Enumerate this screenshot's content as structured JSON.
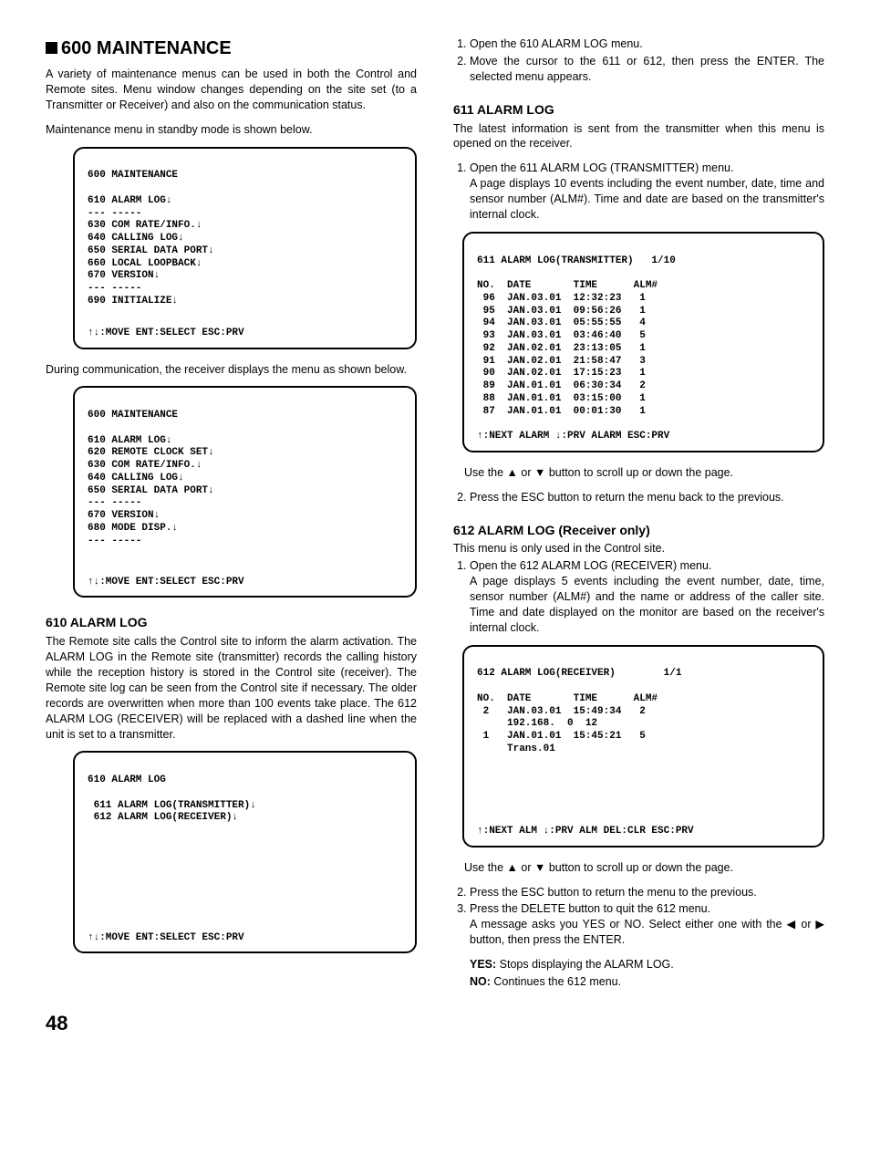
{
  "left": {
    "heading": "600 MAINTENANCE",
    "intro1": "A variety of maintenance menus can be used in both the Control and Remote sites. Menu window changes depending on the site set (to a Transmitter or Receiver) and also on the communication status.",
    "intro2": "Maintenance menu in standby mode is shown below.",
    "term1": "600 MAINTENANCE\n\n610 ALARM LOG↓\n--- -----\n630 COM RATE/INFO.↓\n640 CALLING LOG↓\n650 SERIAL DATA PORT↓\n660 LOCAL LOOPBACK↓\n670 VERSION↓\n--- -----\n690 INITIALIZE↓",
    "term1_footer": "↑↓:MOVE ENT:SELECT ESC:PRV",
    "intro3": "During communication, the receiver displays the menu as shown below.",
    "term2": "600 MAINTENANCE\n\n610 ALARM LOG↓\n620 REMOTE CLOCK SET↓\n630 COM RATE/INFO.↓\n640 CALLING LOG↓\n650 SERIAL DATA PORT↓\n--- -----\n670 VERSION↓\n680 MODE DISP.↓\n--- -----",
    "term2_footer": "↑↓:MOVE ENT:SELECT ESC:PRV",
    "h610": "610 ALARM LOG",
    "p610": "The Remote site calls the Control site to inform the alarm activation. The ALARM LOG in the Remote site (transmitter) records the calling history while the reception history is stored in the Control site (receiver). The Remote site log can be seen from the Control site if necessary. The older records are overwritten when more than 100 events take place. The 612 ALARM LOG (RECEIVER) will be replaced with a dashed line when the unit is set to a transmitter.",
    "term3": "610 ALARM LOG\n\n 611 ALARM LOG(TRANSMITTER)↓\n 612 ALARM LOG(RECEIVER)↓",
    "term3_footer": "↑↓:MOVE ENT:SELECT ESC:PRV"
  },
  "right": {
    "step1": "Open the 610 ALARM LOG menu.",
    "step2": "Move the cursor to the 611 or 612, then press the ENTER. The selected menu appears.",
    "h611": "611 ALARM LOG",
    "p611": "The latest information is sent from the transmitter when this menu is opened on the receiver.",
    "p611_sub": "Open the 611 ALARM LOG (TRANSMITTER) menu.\nA page displays 10 events including the event number, date, time and sensor number (ALM#). Time and date are based on the transmitter's internal clock.",
    "term4": "611 ALARM LOG(TRANSMITTER)   1/10\n\nNO.  DATE       TIME      ALM#\n 96  JAN.03.01  12:32:23   1\n 95  JAN.03.01  09:56:26   1\n 94  JAN.03.01  05:55:55   4\n 93  JAN.03.01  03:46:40   5\n 92  JAN.02.01  23:13:05   1\n 91  JAN.02.01  21:58:47   3\n 90  JAN.02.01  17:15:23   1\n 89  JAN.01.01  06:30:34   2\n 88  JAN.01.01  03:15:00   1\n 87  JAN.01.01  00:01:30   1",
    "term4_footer": "↑:NEXT ALARM ↓:PRV ALARM ESC:PRV",
    "p611_after": "Use the ▲ or ▼ button to scroll up or down the page.",
    "p611_step2": "Press the ESC button to return the menu back to the previous.",
    "h612": "612 ALARM LOG (Receiver only)",
    "p612a": "This menu is only used in the Control site.",
    "p612_step1": "Open the 612 ALARM LOG (RECEIVER) menu.\nA page displays 5 events including the event number, date, time, sensor number (ALM#) and the name or address of the caller site. Time and date displayed on the monitor are based on the receiver's internal clock.",
    "term5": "612 ALARM LOG(RECEIVER)        1/1\n\nNO.  DATE       TIME      ALM#\n 2   JAN.03.01  15:49:34   2\n     192.168.  0  12\n 1   JAN.01.01  15:45:21   5\n     Trans.01",
    "term5_footer": "↑:NEXT ALM ↓:PRV ALM DEL:CLR ESC:PRV",
    "p612_after": "Use the ▲ or ▼ button to scroll up or down the page.",
    "p612_step2": "Press the ESC button to return the menu to the previous.",
    "p612_step3": "Press the DELETE button to quit the 612 menu.\nA message asks you YES or NO. Select either one with the ◀ or ▶ button, then press the ENTER.",
    "yes_line": "YES: Stops displaying the ALARM LOG.",
    "no_line": "NO: Continues the 612 menu."
  },
  "page_number": "48"
}
